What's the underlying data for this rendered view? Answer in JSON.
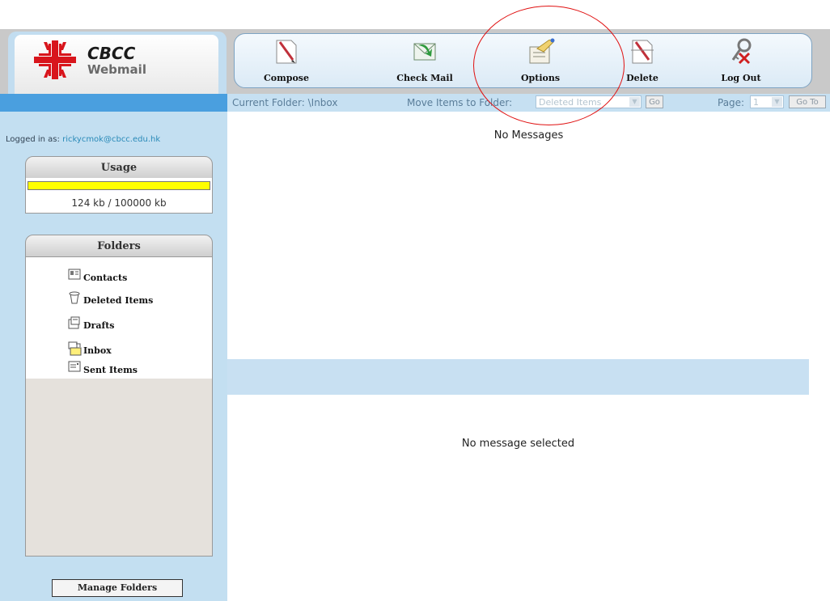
{
  "logo": {
    "brand": "CBCC",
    "product": "Webmail"
  },
  "toolbar": {
    "compose": "Compose",
    "check_mail": "Check Mail",
    "options": "Options",
    "delete": "Delete",
    "log_out": "Log Out"
  },
  "folder_bar": {
    "current_folder": "Current Folder: \\Inbox",
    "move_label": "Move Items to Folder:",
    "move_selected": "Deleted Items",
    "go": "Go",
    "page_label": "Page:",
    "page_selected": "1",
    "goto": "Go To"
  },
  "sidebar": {
    "logged_in_label": "Logged in as:",
    "user": "rickycmok@cbcc.edu.hk",
    "usage_title": "Usage",
    "usage_fraction": 1.0,
    "usage_text": "124 kb / 100000 kb",
    "folders_title": "Folders",
    "folders": [
      {
        "label": "Contacts",
        "icon": "contacts-icon"
      },
      {
        "label": "Deleted Items",
        "icon": "trash-icon"
      },
      {
        "label": "Drafts",
        "icon": "drafts-icon"
      },
      {
        "label": "Inbox",
        "icon": "inbox-icon"
      },
      {
        "label": "Sent Items",
        "icon": "sent-icon"
      }
    ],
    "manage_folders": "Manage Folders"
  },
  "main": {
    "no_messages": "No Messages",
    "no_selection": "No message selected"
  },
  "colors": {
    "accent_blue": "#4a9fdf",
    "panel_blue": "#c3dff1",
    "usage_yellow": "#ffff00",
    "highlight_red": "#e01010"
  }
}
